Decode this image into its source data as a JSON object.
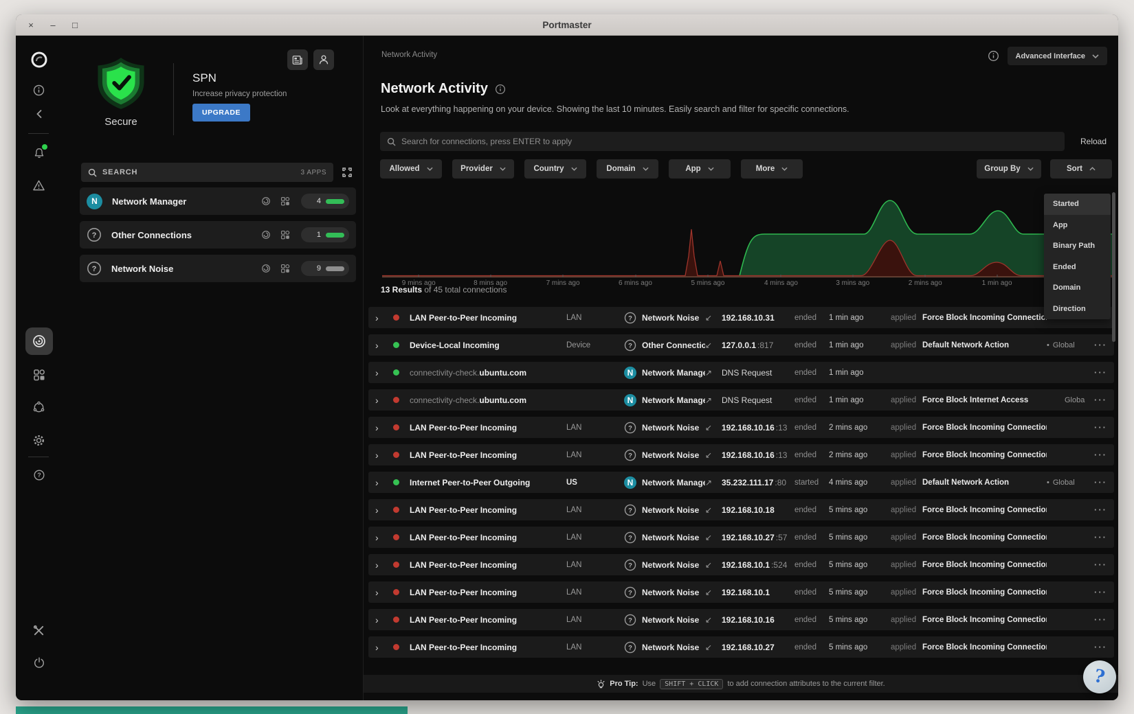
{
  "window": {
    "title": "Portmaster",
    "controls": [
      "close",
      "minimize",
      "maximize"
    ]
  },
  "sidebar": {
    "icons": [
      "portmaster-logo",
      "info",
      "back",
      "notifications",
      "warning",
      "network-activity",
      "apps",
      "spn",
      "settings",
      "help",
      "dev-tools",
      "shutdown"
    ],
    "active_icon": "network-activity"
  },
  "left_panel": {
    "status_label": "Secure",
    "spn": {
      "title": "SPN",
      "subtitle": "Increase privacy protection",
      "upgrade_label": "UPGRADE"
    },
    "header_icons": [
      "news-icon",
      "account-icon"
    ],
    "search": {
      "label": "SEARCH",
      "apps_count": "3 APPS"
    },
    "apps": [
      {
        "name": "Network Manager",
        "badge": "N",
        "count": "4",
        "bar": "green"
      },
      {
        "name": "Other Connections",
        "badge": "question",
        "count": "1",
        "bar": "green"
      },
      {
        "name": "Network Noise",
        "badge": "question",
        "count": "9",
        "bar": "gray"
      }
    ]
  },
  "main": {
    "breadcrumb": "Network Activity",
    "interface_selector": "Advanced Interface",
    "title": "Network Activity",
    "subtitle": "Look at everything happening on your device. Showing the last 10 minutes. Easily search and filter for specific connections.",
    "search_placeholder": "Search for connections, press ENTER to apply",
    "reload_label": "Reload",
    "filters": [
      "Allowed",
      "Provider",
      "Country",
      "Domain",
      "App",
      "More"
    ],
    "group_by_label": "Group By",
    "sort_label": "Sort",
    "sort_menu": {
      "items": [
        "Started",
        "App",
        "Binary Path",
        "Ended",
        "Domain",
        "Direction"
      ],
      "active": "Started"
    },
    "chart": {
      "type": "area",
      "x_labels": [
        "9 mins ago",
        "8 mins ago",
        "7 mins ago",
        "6 mins ago",
        "5 mins ago",
        "4 mins ago",
        "3 mins ago",
        "2 mins ago",
        "1 min ago"
      ],
      "series_colors": {
        "allowed": "#2eb84f",
        "blocked": "#9e342b"
      }
    },
    "results": {
      "bold": "13 Results",
      "rest": "of 45 total connections"
    },
    "rows": [
      {
        "status": "blocked",
        "name": "LAN Peer-to-Peer Incoming",
        "scope": "LAN",
        "app_icon": "question",
        "app": "Network Noise",
        "direction": "incoming",
        "entity": "192.168.10.31",
        "port": "",
        "state": "ended",
        "time": "1 min ago",
        "applied": "applied",
        "action": "Force Block Incoming Connection",
        "global": ""
      },
      {
        "status": "allowed",
        "name": "Device-Local Incoming",
        "scope": "Device",
        "app_icon": "question",
        "app": "Other Connections",
        "direction": "incoming",
        "entity": "127.0.0.1",
        "port": ":817",
        "state": "ended",
        "time": "1 min ago",
        "applied": "applied",
        "action": "Default Network Action",
        "global": "Global"
      },
      {
        "status": "allowed",
        "name_prefix": "connectivity-check.",
        "name": "ubuntu.com",
        "scope": "",
        "app_icon": "N",
        "app": "Network Manager",
        "direction": "outgoing",
        "entity": "DNS Request",
        "entity_plain": true,
        "port": "",
        "state": "ended",
        "time": "1 min ago",
        "applied": "",
        "action": "",
        "global": ""
      },
      {
        "status": "blocked",
        "name_prefix": "connectivity-check.",
        "name": "ubuntu.com",
        "scope": "",
        "app_icon": "N",
        "app": "Network Manager",
        "direction": "outgoing",
        "entity": "DNS Request",
        "entity_plain": true,
        "port": "",
        "state": "ended",
        "time": "1 min ago",
        "applied": "applied",
        "action": "Force Block Internet Access",
        "global": "Global",
        "global_clipped": true
      },
      {
        "status": "blocked",
        "name": "LAN Peer-to-Peer Incoming",
        "scope": "LAN",
        "app_icon": "question",
        "app": "Network Noise",
        "direction": "incoming",
        "entity": "192.168.10.16",
        "port": ":13",
        "state": "ended",
        "time": "2 mins ago",
        "applied": "applied",
        "action": "Force Block Incoming Connection",
        "global": ""
      },
      {
        "status": "blocked",
        "name": "LAN Peer-to-Peer Incoming",
        "scope": "LAN",
        "app_icon": "question",
        "app": "Network Noise",
        "direction": "incoming",
        "entity": "192.168.10.16",
        "port": ":13",
        "state": "ended",
        "time": "2 mins ago",
        "applied": "applied",
        "action": "Force Block Incoming Connection",
        "global": ""
      },
      {
        "status": "allowed",
        "name": "Internet Peer-to-Peer Outgoing",
        "scope": "US",
        "scope_bright": true,
        "app_icon": "N",
        "app": "Network Manager",
        "direction": "outgoing",
        "entity": "35.232.111.17",
        "port": ":80",
        "state": "started",
        "time": "4 mins ago",
        "applied": "applied",
        "action": "Default Network Action",
        "global": "Global"
      },
      {
        "status": "blocked",
        "name": "LAN Peer-to-Peer Incoming",
        "scope": "LAN",
        "app_icon": "question",
        "app": "Network Noise",
        "direction": "incoming",
        "entity": "192.168.10.18",
        "port": "",
        "state": "ended",
        "time": "5 mins ago",
        "applied": "applied",
        "action": "Force Block Incoming Connection",
        "global": ""
      },
      {
        "status": "blocked",
        "name": "LAN Peer-to-Peer Incoming",
        "scope": "LAN",
        "app_icon": "question",
        "app": "Network Noise",
        "direction": "incoming",
        "entity": "192.168.10.27",
        "port": ":57",
        "state": "ended",
        "time": "5 mins ago",
        "applied": "applied",
        "action": "Force Block Incoming Connection",
        "global": ""
      },
      {
        "status": "blocked",
        "name": "LAN Peer-to-Peer Incoming",
        "scope": "LAN",
        "app_icon": "question",
        "app": "Network Noise",
        "direction": "incoming",
        "entity": "192.168.10.1",
        "port": ":524",
        "state": "ended",
        "time": "5 mins ago",
        "applied": "applied",
        "action": "Force Block Incoming Connection",
        "global": ""
      },
      {
        "status": "blocked",
        "name": "LAN Peer-to-Peer Incoming",
        "scope": "LAN",
        "app_icon": "question",
        "app": "Network Noise",
        "direction": "incoming",
        "entity": "192.168.10.1",
        "port": "",
        "state": "ended",
        "time": "5 mins ago",
        "applied": "applied",
        "action": "Force Block Incoming Connection",
        "global": ""
      },
      {
        "status": "blocked",
        "name": "LAN Peer-to-Peer Incoming",
        "scope": "LAN",
        "app_icon": "question",
        "app": "Network Noise",
        "direction": "incoming",
        "entity": "192.168.10.16",
        "port": "",
        "state": "ended",
        "time": "5 mins ago",
        "applied": "applied",
        "action": "Force Block Incoming Connection",
        "global": ""
      },
      {
        "status": "blocked",
        "name": "LAN Peer-to-Peer Incoming",
        "scope": "LAN",
        "app_icon": "question",
        "app": "Network Noise",
        "direction": "incoming",
        "entity": "192.168.10.27",
        "port": "",
        "state": "ended",
        "time": "5 mins ago",
        "applied": "applied",
        "action": "Force Block Incoming Connection",
        "global": ""
      }
    ],
    "protip": {
      "bold": "Pro Tip:",
      "pre": "Use",
      "kbd": "SHIFT + CLICK",
      "post": "to add connection attributes to the current filter."
    }
  },
  "colors": {
    "accent_green": "#2ee54a",
    "accent_blue": "#3c79c7",
    "teal_badge": "#1c8da1",
    "blocked_red": "#c23a30",
    "allowed_green": "#36c253"
  }
}
